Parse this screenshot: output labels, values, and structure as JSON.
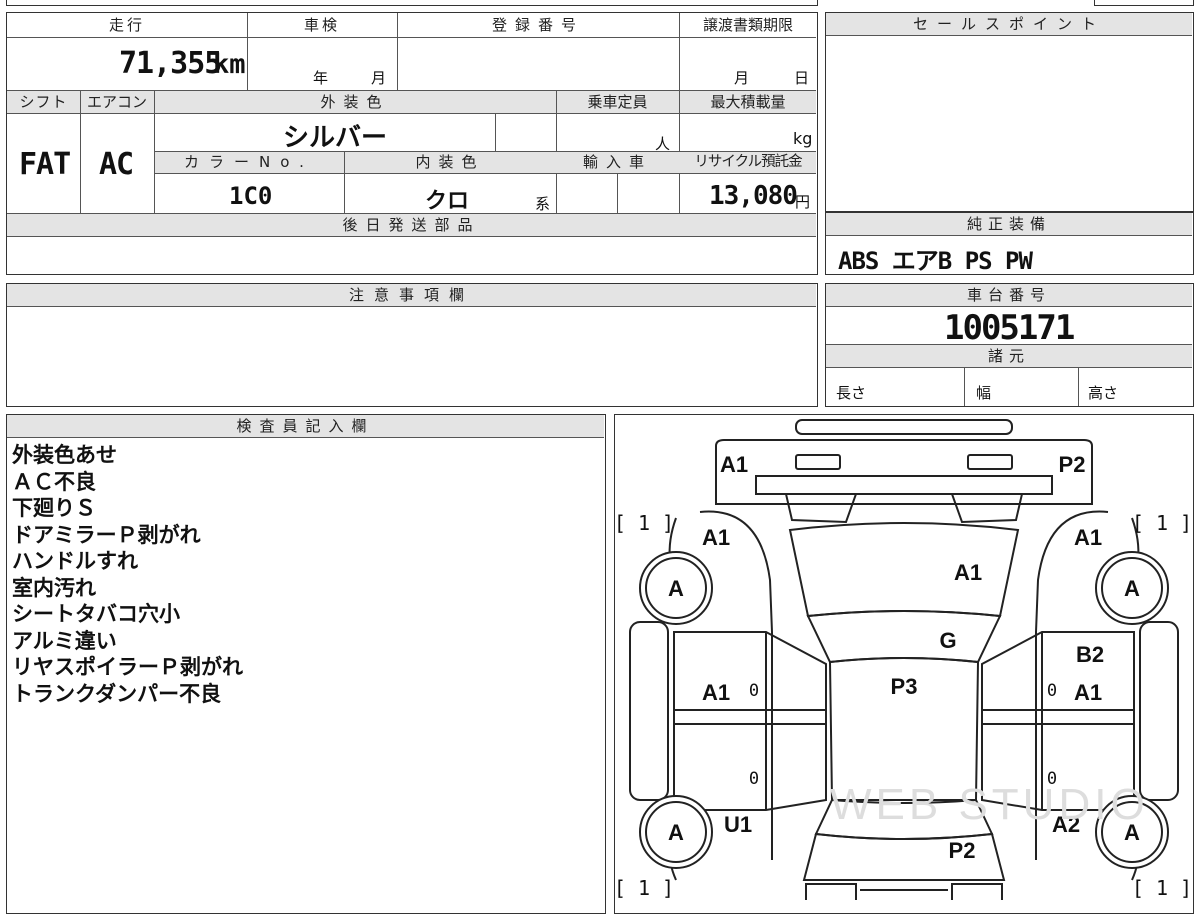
{
  "form": {
    "mileage": {
      "label": "走行",
      "value": "71,355",
      "unit": "km"
    },
    "shaken": {
      "label": "車検",
      "year_unit": "年",
      "month_unit": "月"
    },
    "registration": {
      "label": "登録番号"
    },
    "transfer_deadline": {
      "label": "譲渡書類期限",
      "month_unit": "月",
      "day_unit": "日"
    },
    "shift": {
      "label": "シフト",
      "value": "FAT"
    },
    "aircon": {
      "label": "エアコン",
      "value": "AC"
    },
    "exterior_color": {
      "label": "外装色",
      "value": "シルバー"
    },
    "capacity": {
      "label": "乗車定員",
      "unit": "人"
    },
    "max_load": {
      "label": "最大積載量",
      "unit": "kg"
    },
    "color_no": {
      "label": "カラーNo.",
      "value": "1C0"
    },
    "interior_color": {
      "label": "内装色",
      "value": "クロ",
      "suffix": "系"
    },
    "import": {
      "label": "輸入車"
    },
    "recycle": {
      "label": "リサイクル預託金",
      "value": "13,080",
      "unit": "円"
    },
    "later_parts": {
      "label": "後日発送部品"
    },
    "sales_point": {
      "label": "セールスポイント"
    },
    "genuine_equipment": {
      "label": "純正装備",
      "value": "ABS エアB PS PW"
    },
    "caution": {
      "label": "注意事項欄"
    },
    "chassis": {
      "label": "車台番号",
      "value": "1005171"
    },
    "specs": {
      "label": "諸元",
      "length": "長さ",
      "width": "幅",
      "height": "高さ"
    },
    "inspector": {
      "label": "検査員記入欄",
      "notes": [
        "外装色あせ",
        "ＡＣ不良",
        "下廻りＳ",
        "ドアミラーＰ剥がれ",
        "ハンドルすれ",
        "室内汚れ",
        "シートタバコ穴小",
        "アルミ違い",
        "リヤスポイラーＰ剥がれ",
        "トランクダンパー不良"
      ]
    }
  },
  "diagram": {
    "marks": {
      "front_left": "A1",
      "front_right": "P2",
      "fender_left": "A1",
      "fender_right": "A1",
      "hood": "A1",
      "windshield": "G",
      "roof": "P3",
      "front_door_left": "A1",
      "front_door_right": "A1",
      "pillar_right": "B2",
      "rear_fender_left": "U1",
      "rear_fender_right": "A2",
      "trunk": "P2",
      "wheel": "A",
      "tire_count": "[ 1 ]",
      "zero": "0"
    },
    "watermark": "WEB STUDIO"
  }
}
